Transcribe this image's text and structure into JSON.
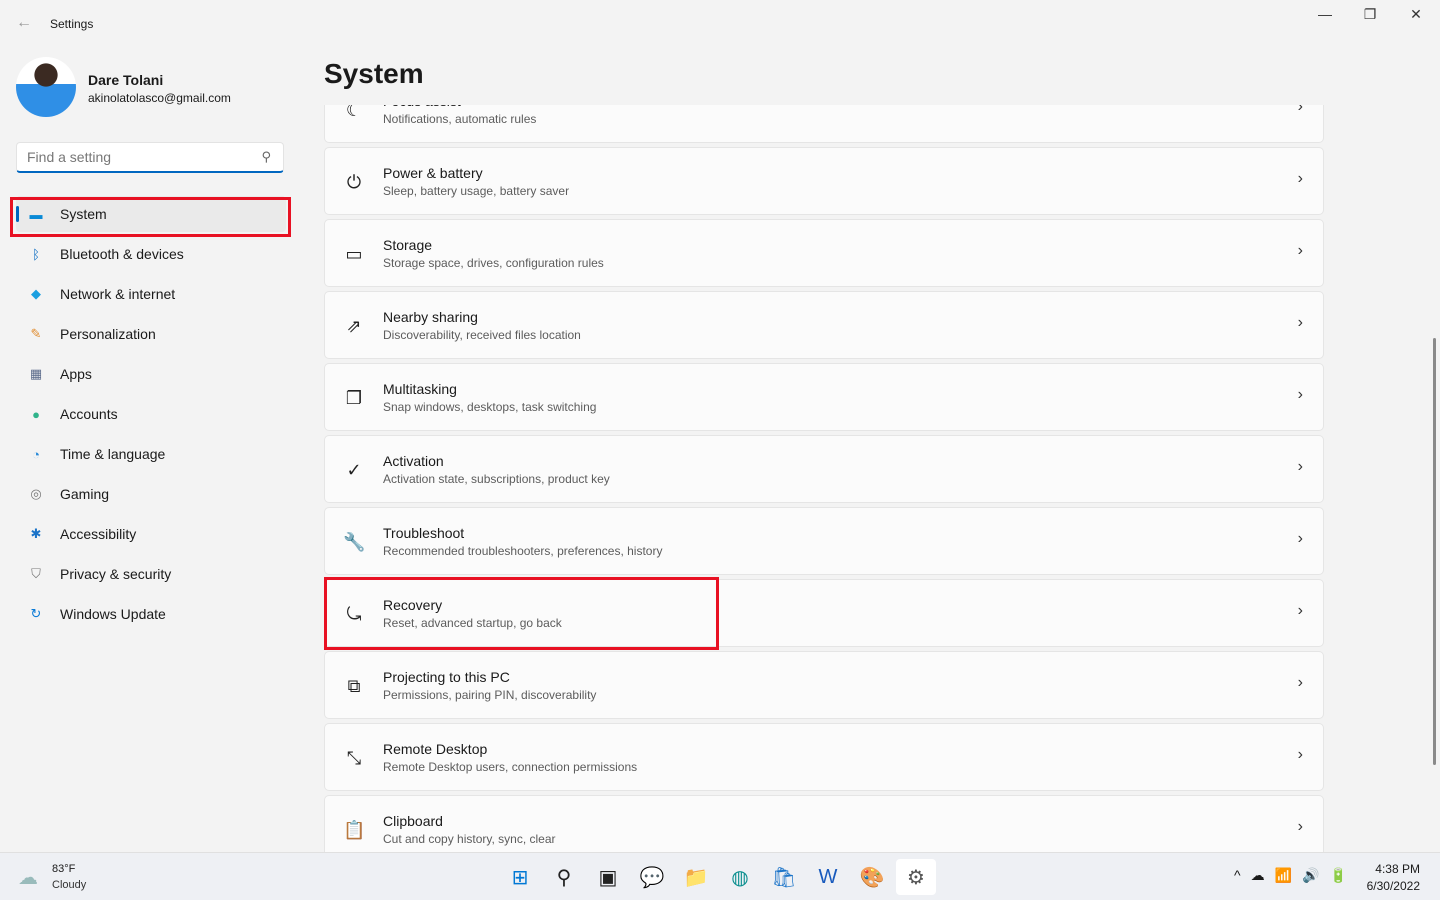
{
  "window": {
    "title": "Settings",
    "minimize": "—",
    "maximize": "❐",
    "close": "✕",
    "back": "←"
  },
  "profile": {
    "name": "Dare Tolani",
    "email": "akinolatolasco@gmail.com"
  },
  "search": {
    "placeholder": "Find a setting",
    "icon": "search-icon"
  },
  "sidebar": {
    "items": [
      {
        "label": "System",
        "icon": "▬",
        "color": "#0a8ad6",
        "active": true
      },
      {
        "label": "Bluetooth & devices",
        "icon": "ᛒ",
        "color": "#0067c0"
      },
      {
        "label": "Network & internet",
        "icon": "◆",
        "color": "#1a9fe0"
      },
      {
        "label": "Personalization",
        "icon": "✎",
        "color": "#e08a2b"
      },
      {
        "label": "Apps",
        "icon": "▦",
        "color": "#5a6a8a"
      },
      {
        "label": "Accounts",
        "icon": "●",
        "color": "#2fb38a"
      },
      {
        "label": "Time & language",
        "icon": "◔",
        "color": "#2a8ad8"
      },
      {
        "label": "Gaming",
        "icon": "◎",
        "color": "#777"
      },
      {
        "label": "Accessibility",
        "icon": "✱",
        "color": "#1a73c8"
      },
      {
        "label": "Privacy & security",
        "icon": "⛉",
        "color": "#777"
      },
      {
        "label": "Windows Update",
        "icon": "↻",
        "color": "#0a7ad6"
      }
    ]
  },
  "main": {
    "title": "System",
    "items": [
      {
        "title": "Focus assist",
        "subtitle": "Notifications, automatic rules",
        "icon": "☾"
      },
      {
        "title": "Power & battery",
        "subtitle": "Sleep, battery usage, battery saver",
        "icon": "⏻"
      },
      {
        "title": "Storage",
        "subtitle": "Storage space, drives, configuration rules",
        "icon": "▭"
      },
      {
        "title": "Nearby sharing",
        "subtitle": "Discoverability, received files location",
        "icon": "⇗"
      },
      {
        "title": "Multitasking",
        "subtitle": "Snap windows, desktops, task switching",
        "icon": "❐"
      },
      {
        "title": "Activation",
        "subtitle": "Activation state, subscriptions, product key",
        "icon": "✓"
      },
      {
        "title": "Troubleshoot",
        "subtitle": "Recommended troubleshooters, preferences, history",
        "icon": "🔧"
      },
      {
        "title": "Recovery",
        "subtitle": "Reset, advanced startup, go back",
        "icon": "⤿"
      },
      {
        "title": "Projecting to this PC",
        "subtitle": "Permissions, pairing PIN, discoverability",
        "icon": "⧉"
      },
      {
        "title": "Remote Desktop",
        "subtitle": "Remote Desktop users, connection permissions",
        "icon": "⤡"
      },
      {
        "title": "Clipboard",
        "subtitle": "Cut and copy history, sync, clear",
        "icon": "📋"
      }
    ]
  },
  "highlight_color": "#e81123",
  "accent": "#0067c0",
  "taskbar": {
    "weather": {
      "temp": "83°F",
      "condition": "Cloudy"
    },
    "apps": [
      {
        "name": "start",
        "icon": "⊞",
        "color": "#0078d4"
      },
      {
        "name": "search",
        "icon": "⚲",
        "color": "#222"
      },
      {
        "name": "task-view",
        "icon": "▣",
        "color": "#222"
      },
      {
        "name": "chat",
        "icon": "💬",
        "color": "#6264a7"
      },
      {
        "name": "file-explorer",
        "icon": "📁",
        "color": "#f3b53b"
      },
      {
        "name": "edge",
        "icon": "◍",
        "color": "#0c8f8f"
      },
      {
        "name": "store",
        "icon": "🛍",
        "color": "#1a73c8"
      },
      {
        "name": "word",
        "icon": "W",
        "color": "#185abd"
      },
      {
        "name": "paint",
        "icon": "🎨",
        "color": "#d86"
      },
      {
        "name": "settings",
        "icon": "⚙",
        "color": "#555",
        "active": true
      }
    ],
    "tray": [
      "^",
      "☁",
      "📶",
      "🔊",
      "🔋"
    ],
    "time": "4:38 PM",
    "date": "6/30/2022"
  }
}
